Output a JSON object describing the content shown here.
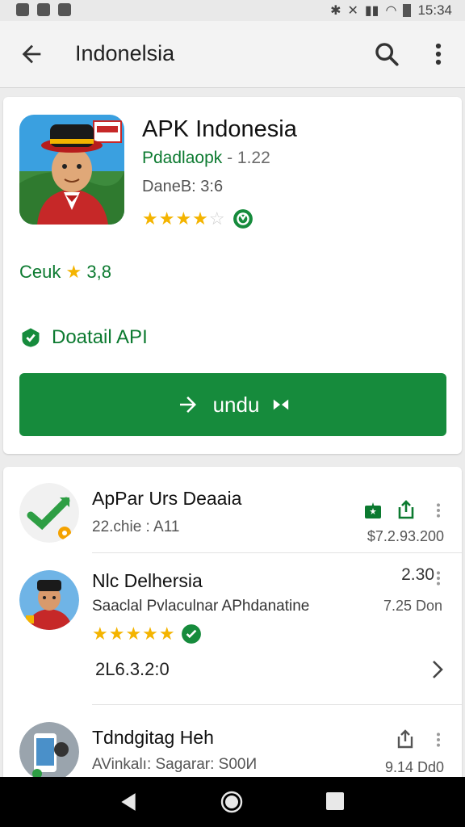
{
  "status_bar": {
    "time": "15:34"
  },
  "toolbar": {
    "title": "Indonelsia"
  },
  "app": {
    "title": "APK Indonesia",
    "developer": "Pdadlaopk",
    "version": "- 1.22",
    "date": "DaneB: 3:6",
    "stars": 3.5,
    "rating_label": "Ceuk",
    "rating_value": "3,8",
    "detail_label": "Doatail API",
    "install_label": "undu"
  },
  "list": {
    "items": [
      {
        "title": "ApPar Urs Deaaia",
        "subtitle": "22.chie : A11",
        "right_text": "$7.2.93.200"
      },
      {
        "title": "Nlc Delhersia",
        "subtitle": "Saaclal Pvlaculnar APhdanatine",
        "right_top": "2.30",
        "right_bottom": "7.25 Don",
        "stars": 5,
        "extra": "2L6.3.2:0"
      },
      {
        "title": "Tdndgitag Heh",
        "subtitle": "AVinkalı: Sagarar: S00И",
        "right_text": "9.14 Dd0"
      }
    ]
  },
  "colors": {
    "accent_green": "#168b3c",
    "link_green": "#0c7a30",
    "star": "#f4b400"
  }
}
